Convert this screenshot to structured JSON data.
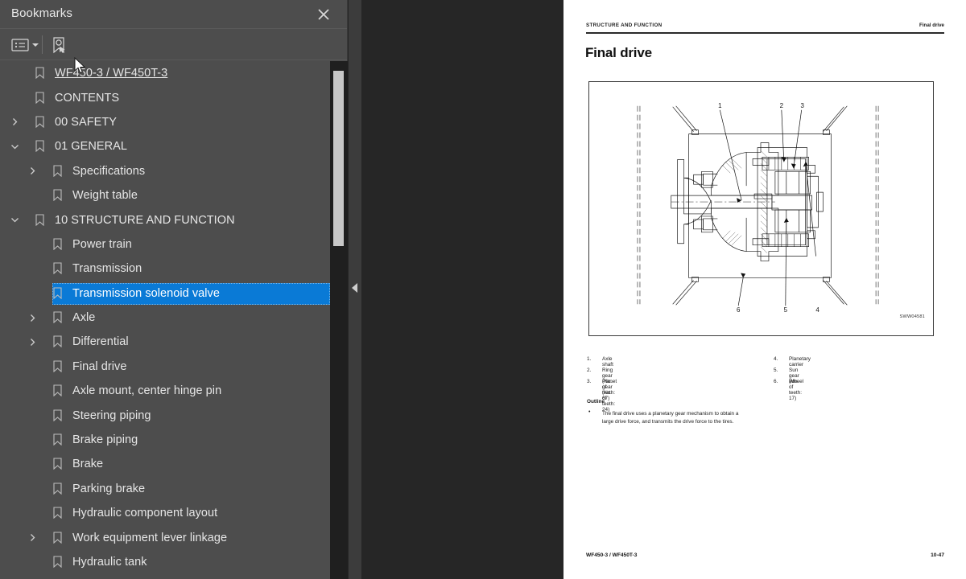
{
  "sidebar": {
    "title": "Bookmarks",
    "close_icon": "close-icon",
    "toolbar": {
      "list_options_label": "list-options-icon",
      "find_bookmark_label": "find-bookmark-icon"
    },
    "items": [
      {
        "label": "WF450-3 / WF450T-3",
        "depth": 0,
        "twisty": "none",
        "style": "link",
        "selected": false
      },
      {
        "label": "CONTENTS",
        "depth": 0,
        "twisty": "none",
        "style": "plain",
        "selected": false
      },
      {
        "label": "00 SAFETY",
        "depth": 0,
        "twisty": "collapsed",
        "style": "plain",
        "selected": false
      },
      {
        "label": "01 GENERAL",
        "depth": 0,
        "twisty": "expanded",
        "style": "plain",
        "selected": false
      },
      {
        "label": "Specifications",
        "depth": 1,
        "twisty": "collapsed",
        "style": "plain",
        "selected": false
      },
      {
        "label": "Weight table",
        "depth": 1,
        "twisty": "none",
        "style": "plain",
        "selected": false
      },
      {
        "label": "10 STRUCTURE AND FUNCTION",
        "depth": 0,
        "twisty": "expanded",
        "style": "plain",
        "selected": false
      },
      {
        "label": "Power train",
        "depth": 1,
        "twisty": "none",
        "style": "plain",
        "selected": false
      },
      {
        "label": "Transmission",
        "depth": 1,
        "twisty": "none",
        "style": "plain",
        "selected": false
      },
      {
        "label": "Transmission solenoid valve",
        "depth": 1,
        "twisty": "none",
        "style": "plain",
        "selected": true
      },
      {
        "label": "Axle",
        "depth": 1,
        "twisty": "collapsed",
        "style": "plain",
        "selected": false
      },
      {
        "label": "Differential",
        "depth": 1,
        "twisty": "collapsed",
        "style": "plain",
        "selected": false
      },
      {
        "label": "Final drive",
        "depth": 1,
        "twisty": "none",
        "style": "plain",
        "selected": false
      },
      {
        "label": "Axle mount, center hinge pin",
        "depth": 1,
        "twisty": "none",
        "style": "plain",
        "selected": false
      },
      {
        "label": "Steering piping",
        "depth": 1,
        "twisty": "none",
        "style": "plain",
        "selected": false
      },
      {
        "label": "Brake piping",
        "depth": 1,
        "twisty": "none",
        "style": "plain",
        "selected": false
      },
      {
        "label": "Brake",
        "depth": 1,
        "twisty": "none",
        "style": "plain",
        "selected": false
      },
      {
        "label": "Parking brake",
        "depth": 1,
        "twisty": "none",
        "style": "plain",
        "selected": false
      },
      {
        "label": "Hydraulic component layout",
        "depth": 1,
        "twisty": "none",
        "style": "plain",
        "selected": false
      },
      {
        "label": "Work equipment lever linkage",
        "depth": 1,
        "twisty": "collapsed",
        "style": "plain",
        "selected": false
      },
      {
        "label": "Hydraulic tank",
        "depth": 1,
        "twisty": "none",
        "style": "plain",
        "selected": false
      }
    ],
    "colors": {
      "background": "#4d4d4d",
      "selection": "#0a7ad6",
      "text": "#e6e6e6"
    }
  },
  "viewer": {
    "background": "#262626",
    "collapse_arrow_icon": "collapse-panel-arrow-icon"
  },
  "document": {
    "header_left": "STRUCTURE AND FUNCTION",
    "header_right": "Final drive",
    "title": "Final drive",
    "figure_code": "SWW04581",
    "legend_column_1": [
      {
        "num": "1.",
        "text": "Axle shaft"
      },
      {
        "num": "2.",
        "text": "Ring gear (No. of teeth: 67)"
      },
      {
        "num": "3.",
        "text": "Planet gear (No. of teeth: 24)"
      }
    ],
    "legend_column_2": [
      {
        "num": "4.",
        "text": "Planetary carrier"
      },
      {
        "num": "5.",
        "text": "Sun gear (No. of teeth: 17)"
      },
      {
        "num": "6.",
        "text": "Wheel"
      }
    ],
    "outline_title": "Outline",
    "outline_line_1": "The final drive uses a planetary gear mechanism to obtain a",
    "outline_line_2": "large drive force, and transmits the drive force to the tires.",
    "footer_left": "WF450-3 / WF450T-3",
    "footer_right": "10-47"
  }
}
